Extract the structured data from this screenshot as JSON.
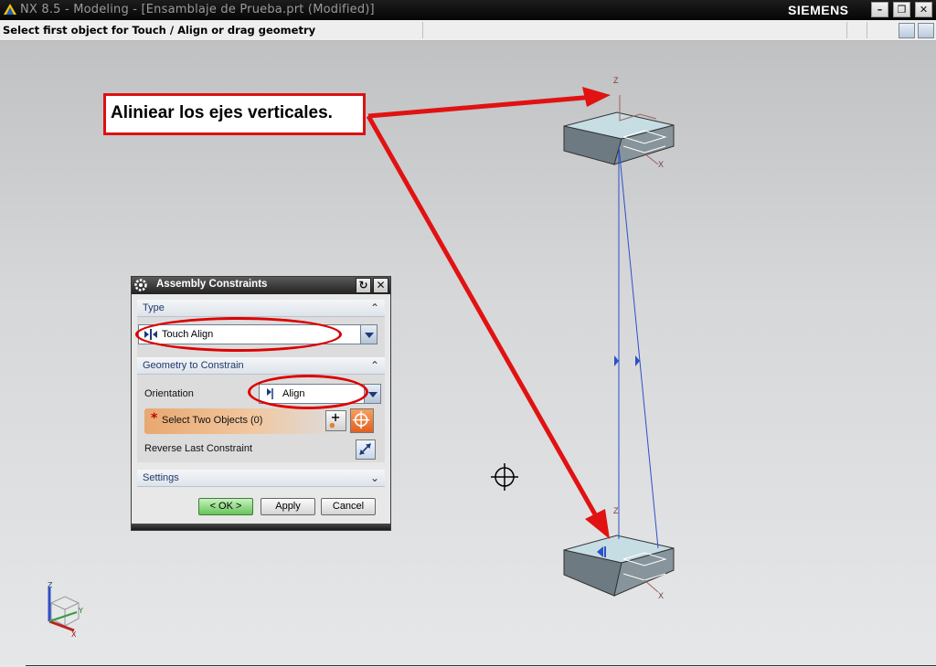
{
  "window": {
    "title": "NX 8.5 - Modeling - [Ensamblaje de Prueba.prt (Modified)]",
    "brand": "SIEMENS",
    "minimize": "–",
    "restore": "❐",
    "close": "✕"
  },
  "cue": {
    "text": "Select first object for Touch / Align or drag geometry"
  },
  "callout": {
    "text": "Aliniear los ejes verticales."
  },
  "axes": {
    "z": "Z",
    "x": "X",
    "y": "Y"
  },
  "dialog": {
    "title": "Assembly Constraints",
    "type_group": "Type",
    "type_value": "Touch Align",
    "geometry_group": "Geometry to Constrain",
    "orientation_label": "Orientation",
    "orientation_value": "Align",
    "select_label": "Select Two Objects (0)",
    "select_marker": "*",
    "reverse_label": "Reverse Last Constraint",
    "settings_group": "Settings",
    "ok": "< OK >",
    "apply": "Apply",
    "cancel": "Cancel"
  },
  "colors": {
    "callout_border": "#dd1111",
    "arrow": "#e11212",
    "ok_button": "#67c45a",
    "constraint_line": "#2d4fc9"
  },
  "icons": [
    "nx-app-icon",
    "gear-icon",
    "reset-icon",
    "close-icon",
    "chevron-up-icon",
    "chevron-down-icon",
    "touch-align-icon",
    "align-icon",
    "add-selection-icon",
    "crosshair-select-icon",
    "reverse-icon",
    "wcs-triad-icon",
    "cursor-crosshair-icon"
  ]
}
